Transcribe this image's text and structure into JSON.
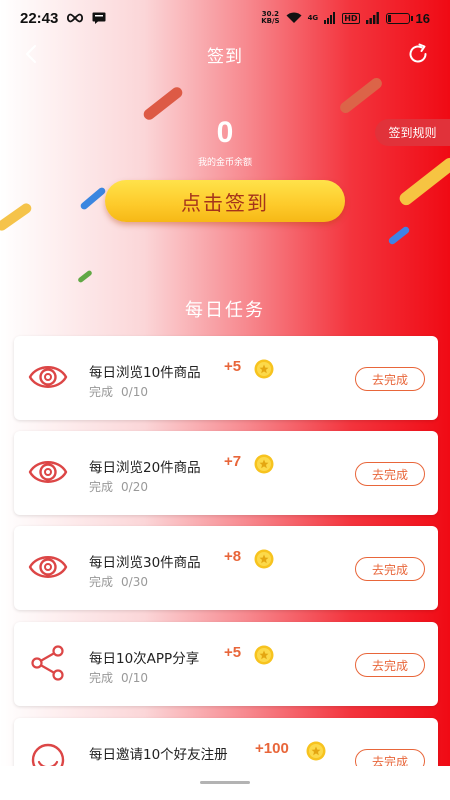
{
  "status_bar": {
    "time": "22:43",
    "speed_value": "30.2",
    "speed_unit": "KB/S",
    "network_label": "4G",
    "hd_label": "HD",
    "battery_level": "16"
  },
  "nav": {
    "title": "签到",
    "back_icon": "chevron-left-icon",
    "refresh_icon": "refresh-icon"
  },
  "balance": {
    "value": "0",
    "label": "我的金币余额"
  },
  "rules_button": "签到规则",
  "signin_button": "点击签到",
  "section_title": "每日任务",
  "progress_label": "完成",
  "action_label": "去完成",
  "tasks": [
    {
      "icon": "eye-icon",
      "name": "每日浏览10件商品",
      "reward": "+5",
      "progress": "0/10"
    },
    {
      "icon": "eye-icon",
      "name": "每日浏览20件商品",
      "reward": "+7",
      "progress": "0/20"
    },
    {
      "icon": "eye-icon",
      "name": "每日浏览30件商品",
      "reward": "+8",
      "progress": "0/30"
    },
    {
      "icon": "share-icon",
      "name": "每日10次APP分享",
      "reward": "+5",
      "progress": "0/10"
    },
    {
      "icon": "smile-icon",
      "name": "每日邀请10个好友注册",
      "reward": "+100",
      "progress": ""
    }
  ],
  "colors": {
    "accent_orange": "#e8663a",
    "button_yellow": "#fdca2a",
    "header_red": "#f00a14",
    "rules_red": "#e1323a"
  }
}
